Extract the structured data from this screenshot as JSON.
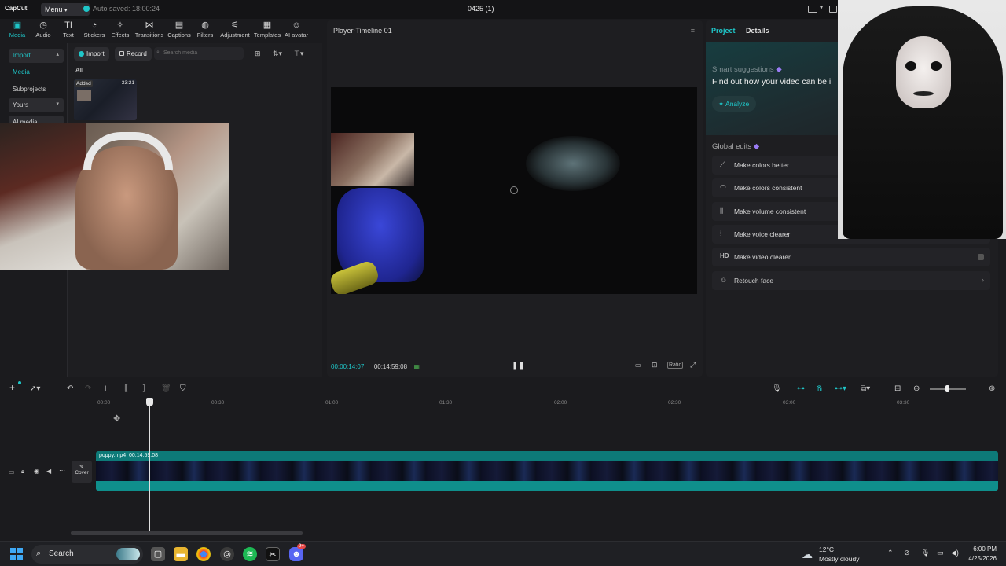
{
  "app": {
    "logo": "CapCut",
    "menu_label": "Menu",
    "autosave": "Auto saved: 18:00:24",
    "project_title": "0425 (1)"
  },
  "toolbar": {
    "items": [
      {
        "label": "Media",
        "icon": "media-icon"
      },
      {
        "label": "Audio",
        "icon": "audio-icon"
      },
      {
        "label": "Text",
        "icon": "text-icon"
      },
      {
        "label": "Stickers",
        "icon": "stickers-icon"
      },
      {
        "label": "Effects",
        "icon": "effects-icon"
      },
      {
        "label": "Transitions",
        "icon": "transitions-icon"
      },
      {
        "label": "Captions",
        "icon": "captions-icon"
      },
      {
        "label": "Filters",
        "icon": "filters-icon"
      },
      {
        "label": "Adjustment",
        "icon": "adjustment-icon"
      },
      {
        "label": "Templates",
        "icon": "templates-icon"
      },
      {
        "label": "AI avatar",
        "icon": "ai-avatar-icon"
      }
    ]
  },
  "sidebar": {
    "items": [
      {
        "label": "Import"
      },
      {
        "label": "Media"
      },
      {
        "label": "Subprojects"
      },
      {
        "label": "Yours"
      },
      {
        "label": "AI media"
      }
    ]
  },
  "media": {
    "import_label": "Import",
    "record_label": "Record",
    "search_placeholder": "Search media",
    "filter_all": "All",
    "thumb_badge": "Added",
    "thumb_duration": "33:21"
  },
  "player": {
    "title": "Player-Timeline 01",
    "current_time": "00:00:14:07",
    "total_time": "00:14:59:08",
    "ratio_label": "Ratio"
  },
  "right_panel": {
    "tab_project": "Project",
    "tab_details": "Details",
    "smart_title": "Smart suggestions",
    "smart_text": "Find out how your video can be i",
    "analyze_label": "Analyze",
    "global_title": "Global edits",
    "edits": [
      {
        "label": "Make colors better"
      },
      {
        "label": "Make colors consistent"
      },
      {
        "label": "Make volume consistent"
      },
      {
        "label": "Make voice clearer"
      },
      {
        "label": "Make video clearer",
        "icon_text": "HD"
      },
      {
        "label": "Retouch face"
      }
    ]
  },
  "timeline": {
    "ruler": [
      "00:00",
      "00:30",
      "01:00",
      "01:30",
      "02:00",
      "02:30",
      "03:00",
      "03:30"
    ],
    "clip_name": "poppy.mp4",
    "clip_duration": "00:14:59:08",
    "cover_label": "Cover"
  },
  "taskbar": {
    "search_label": "Search",
    "weather_temp": "12°C",
    "weather_desc": "Mostly cloudy",
    "time": "6:00 PM",
    "date": "4/25/2026",
    "discord_badge": "9+"
  },
  "colors": {
    "accent": "#1fc6c8",
    "clip": "#0d7a78"
  }
}
